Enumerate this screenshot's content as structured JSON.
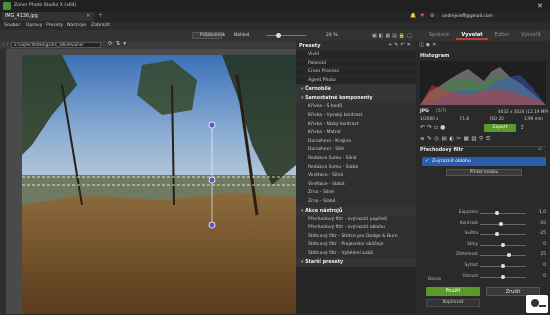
{
  "window": {
    "title": "Zoner Photo Studio X (x64)",
    "doc_tab": "IMG_4136.jpg",
    "account": "ondrejvieff@gmail.com"
  },
  "menu": [
    "Soubor",
    "Úpravy",
    "Presety",
    "Nástroje",
    "Zobrazit"
  ],
  "toolbar": {
    "browser": "Průzkumník",
    "preview": "Náhled",
    "zoom": "24 %"
  },
  "modules": {
    "manager": "Správce",
    "develop": "Vyvolat",
    "editor": "Editor",
    "create": "Vytvořit"
  },
  "path": "Z:\\vojtechfotka\\g2\\01_\\0839\\Zoner",
  "presets_panel": {
    "title": "Presety",
    "top_items": [
      "Vivid",
      "Polaroid",
      "Cross Process",
      "Agent Photo"
    ],
    "sections": [
      {
        "title": "Černobílé",
        "items": []
      },
      {
        "title": "Samostatné komponenty",
        "items": [
          "Křivka - S bodů",
          "Křivka - Vysoký kontrast",
          "Křivka - Nízký kontrast",
          "Křivka - Matné",
          "Dorozhení - Krajina",
          "Dorozhení - Sítě",
          "Redukce šumu - Silná",
          "Redukce šumu - Slabá",
          "Vinětace - Silná",
          "Vinětace - Slabá",
          "Zrno - Silné",
          "Zrno - Slabé"
        ]
      },
      {
        "title": "Akce nástrojů",
        "items": [
          "Přechodový filtr - zvýraznit popředí",
          "Přechodový filtr - zvýraznit oblohu",
          "Štětcový filtr - Štětce pro Dodge & Burn",
          "Štětcový filtr - Projasnění obličeje",
          "Štětcový filtr - Vybělení zubů"
        ]
      },
      {
        "title": "Starší presety",
        "items": []
      }
    ]
  },
  "histogram": {
    "title": "Histogram"
  },
  "info": {
    "format": "JPG",
    "index": "(5/7)",
    "resolution": "4032 x 3024 (12.19 MP)",
    "shutter": "1/2080 s",
    "aperture": "F1.8",
    "iso": "ISO 20",
    "focal": "3.99 mm",
    "export_label": "Export"
  },
  "filter": {
    "panel_title": "Přechodový filtr",
    "preset_name": "Zvýraznit oblohu",
    "add_mask": "Přidat masku",
    "color_label": "Barva"
  },
  "sliders": [
    {
      "label": "Expozice",
      "value": "-1,0",
      "pos": 0.38
    },
    {
      "label": "Kontrast",
      "value": "-10",
      "pos": 0.45
    },
    {
      "label": "Světla",
      "value": "-25",
      "pos": 0.38
    },
    {
      "label": "Stíny",
      "value": "0",
      "pos": 0.5
    },
    {
      "label": "Zřetelnost",
      "value": "25",
      "pos": 0.62
    },
    {
      "label": "Sytost",
      "value": "0",
      "pos": 0.5
    },
    {
      "label": "Ostrost",
      "value": "0",
      "pos": 0.5
    }
  ],
  "buttons": {
    "apply": "Použít",
    "cancel": "Zrušit",
    "copy": "Kopírovat"
  },
  "colors": {
    "accent_green": "#5a9a2a",
    "develop_red": "#c63a3a",
    "bg_panel": "#262626"
  }
}
